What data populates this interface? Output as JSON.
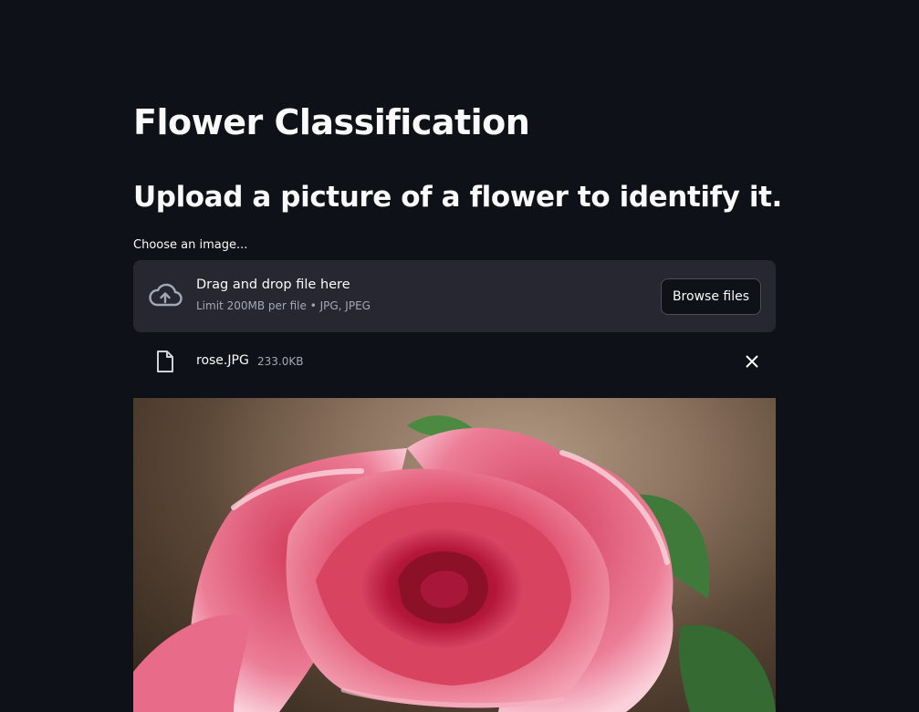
{
  "app": {
    "title": "Flower Classification",
    "subtitle": "Upload a picture of a flower to identify it."
  },
  "uploader": {
    "label": "Choose an image...",
    "instructions": "Drag and drop file here",
    "limit": "Limit 200MB per file • JPG, JPEG",
    "browse_label": "Browse files",
    "icon": "cloud-upload-icon"
  },
  "uploaded_file": {
    "name": "rose.JPG",
    "size": "233.0KB",
    "icon": "file-icon",
    "delete_icon": "close-icon"
  },
  "image": {
    "subject": "rose"
  },
  "colors": {
    "background": "#0e1117",
    "panel": "#262730",
    "text": "#fafafa",
    "muted": "#a3a8b8"
  }
}
